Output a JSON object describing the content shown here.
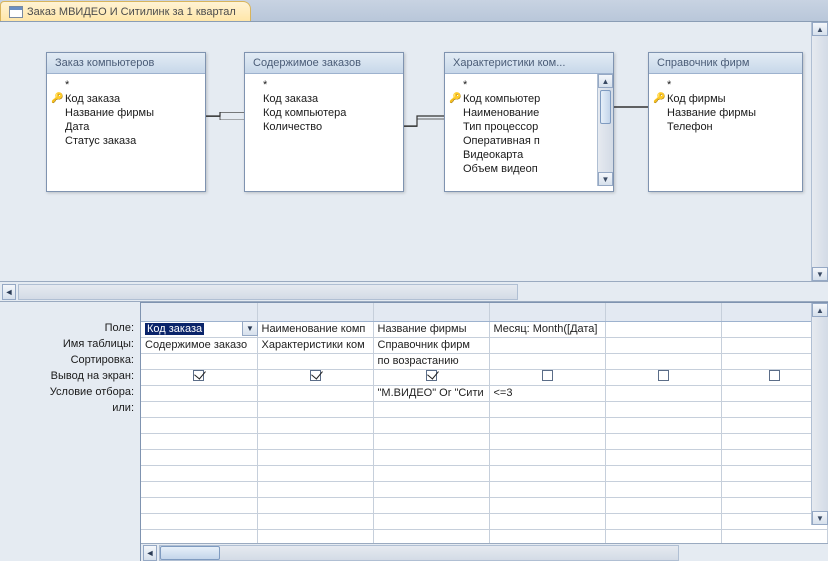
{
  "tab": {
    "title": "Заказ МВИДЕО И Ситилинк за 1 квартал"
  },
  "tables": [
    {
      "name": "Заказ компьютеров",
      "fields": [
        "*",
        "Код заказа",
        "Название фирмы",
        "Дата",
        "Статус заказа"
      ],
      "pk": [
        1
      ],
      "has_scroll": false
    },
    {
      "name": "Содержимое заказов",
      "fields": [
        "*",
        "Код заказа",
        "Код компьютера",
        "Количество"
      ],
      "pk": [],
      "has_scroll": false
    },
    {
      "name": "Характеристики ком...",
      "fields": [
        "*",
        "Код компьютер",
        "Наименование",
        "Тип процессор",
        "Оперативная п",
        "Видеокарта",
        "Объем видеоп"
      ],
      "pk": [
        1
      ],
      "has_scroll": true
    },
    {
      "name": "Справочник фирм",
      "fields": [
        "*",
        "Код фирмы",
        "Название фирмы",
        "Телефон"
      ],
      "pk": [
        1
      ],
      "has_scroll": false
    }
  ],
  "grid": {
    "row_labels": [
      "Поле:",
      "Имя таблицы:",
      "Сортировка:",
      "Вывод на экран:",
      "Условие отбора:",
      "или:"
    ],
    "columns": [
      {
        "field": "Код заказа",
        "selected": true,
        "combo": true,
        "table": "Содержимое заказо",
        "sort": "",
        "show": true,
        "criteria": "",
        "or": ""
      },
      {
        "field": "Наименование комп",
        "table": "Характеристики ком",
        "sort": "",
        "show": true,
        "criteria": "",
        "or": ""
      },
      {
        "field": "Название фирмы",
        "table": "Справочник фирм",
        "sort": "по возрастанию",
        "show": true,
        "criteria": "\"М.ВИДЕО\" Or \"Сити",
        "or": ""
      },
      {
        "field": "Месяц: Month([Дата]",
        "table": "",
        "sort": "",
        "show": false,
        "criteria": "<=3",
        "or": ""
      },
      {
        "field": "",
        "table": "",
        "sort": "",
        "show": false,
        "criteria": "",
        "or": ""
      }
    ]
  }
}
